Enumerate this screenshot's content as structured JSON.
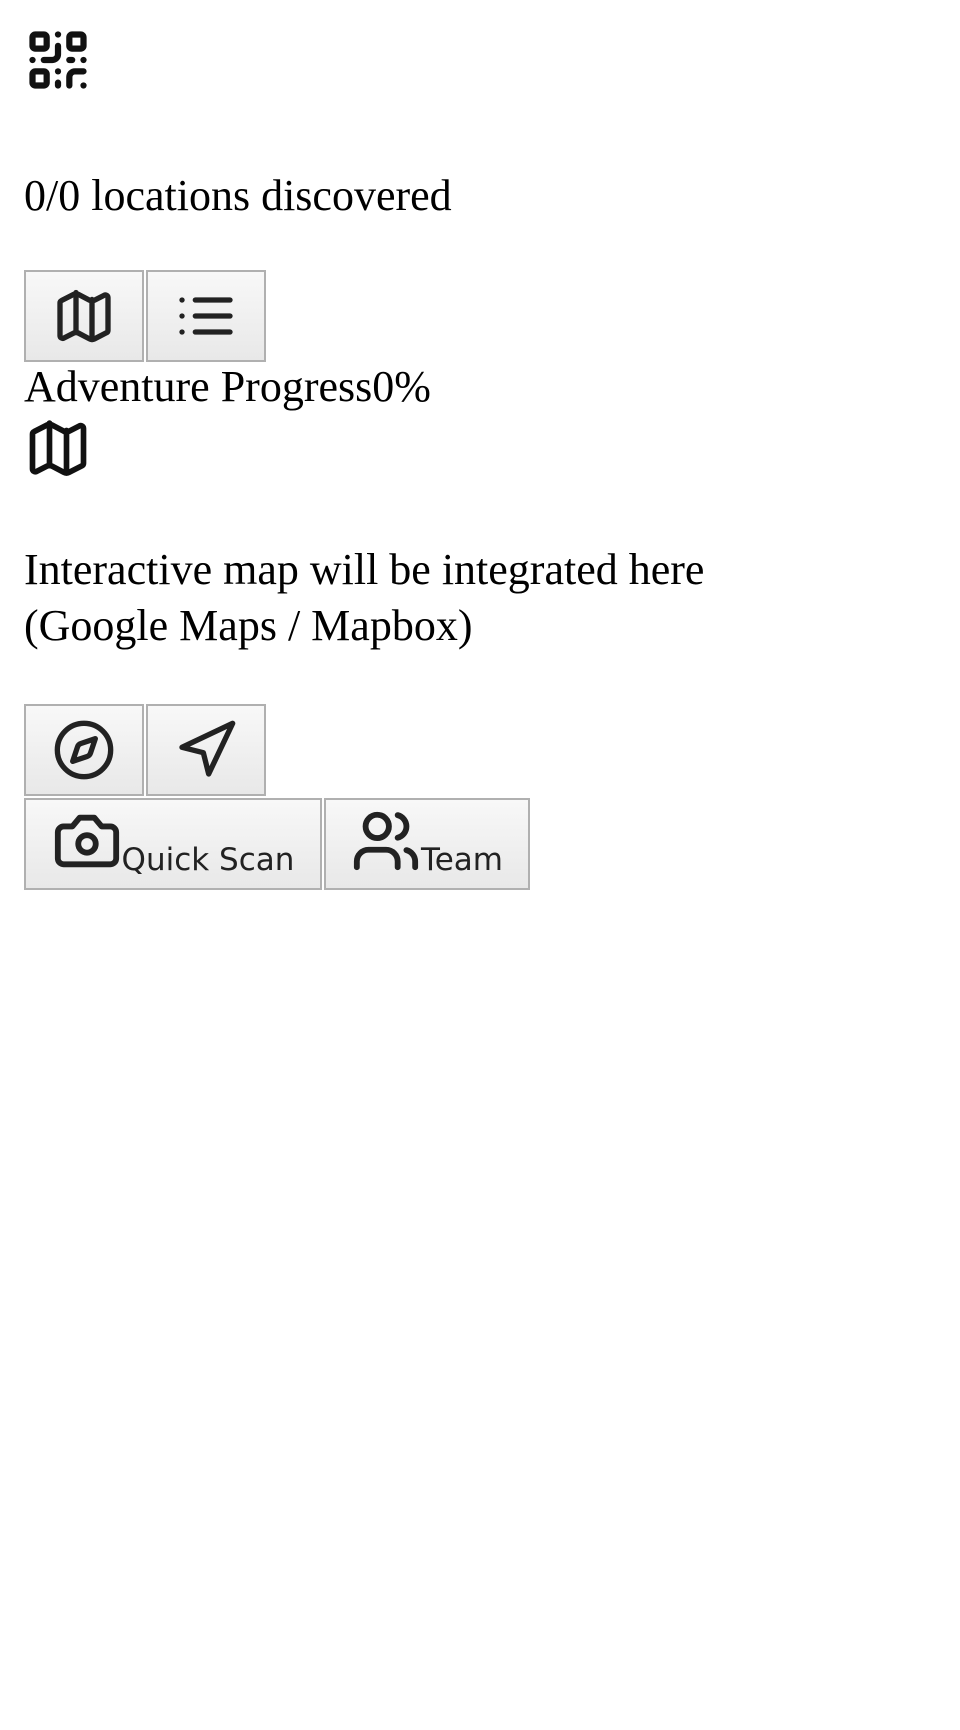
{
  "header": {
    "logo_icon": "qr-code-icon"
  },
  "stats": {
    "locations_text": "0/0 locations discovered"
  },
  "view_toggle": {
    "map_icon": "map-icon",
    "list_icon": "list-icon"
  },
  "progress": {
    "label": "Adventure Progress",
    "value": "0%"
  },
  "map": {
    "icon": "map-icon",
    "placeholder_line1": "Interactive map will be integrated here",
    "placeholder_line2": "(Google Maps / Mapbox)"
  },
  "map_controls": {
    "compass_icon": "compass-icon",
    "navigate_icon": "navigation-arrow-icon"
  },
  "actions": {
    "quick_scan_label": "Quick Scan",
    "quick_scan_icon": "camera-icon",
    "team_label": "Team",
    "team_icon": "users-icon"
  },
  "colors": {
    "icon_stroke": "#222222",
    "button_border": "#b0b0b0",
    "button_bg_top": "#f8f8f8",
    "button_bg_bottom": "#e8e8e8"
  }
}
